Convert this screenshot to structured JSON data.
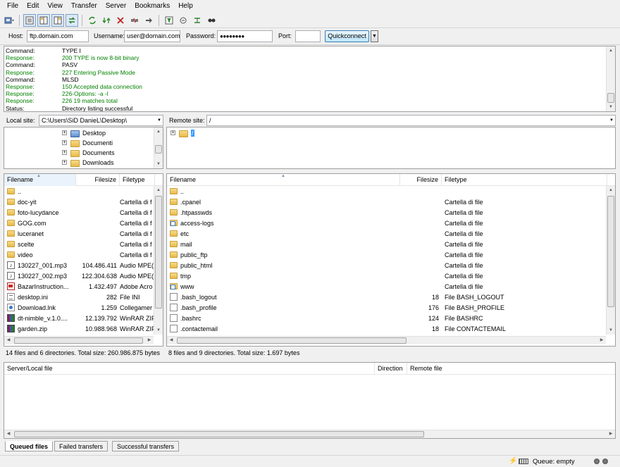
{
  "menu": [
    "File",
    "Edit",
    "View",
    "Transfer",
    "Server",
    "Bookmarks",
    "Help"
  ],
  "toolbar": {
    "icons": [
      "site-manager-icon",
      "toggle-message-log-icon",
      "toggle-local-tree-icon",
      "toggle-remote-tree-icon",
      "toggle-queue-icon",
      "refresh-icon",
      "process-queue-icon",
      "cancel-icon",
      "disconnect-icon",
      "reconnect-icon",
      "directory-filter-icon",
      "compare-icon",
      "sync-browse-icon",
      "search-icon"
    ]
  },
  "quickconnect": {
    "host_label": "Host:",
    "host_value": "ftp.domain.com",
    "username_label": "Username:",
    "username_value": "user@domain.com",
    "password_label": "Password:",
    "password_value": "●●●●●●●●",
    "port_label": "Port:",
    "port_value": "",
    "button_label": "Quickconnect"
  },
  "log": [
    {
      "type": "Command:",
      "msg": "TYPE I",
      "kind": "cmd"
    },
    {
      "type": "Response:",
      "msg": "200 TYPE is now 8-bit binary",
      "kind": "resp"
    },
    {
      "type": "Command:",
      "msg": "PASV",
      "kind": "cmd"
    },
    {
      "type": "Response:",
      "msg": "227 Entering Passive Mode",
      "kind": "resp"
    },
    {
      "type": "Command:",
      "msg": "MLSD",
      "kind": "cmd"
    },
    {
      "type": "Response:",
      "msg": "150 Accepted data connection",
      "kind": "resp"
    },
    {
      "type": "Response:",
      "msg": "226-Options: -a -l",
      "kind": "resp"
    },
    {
      "type": "Response:",
      "msg": "226 19 matches total",
      "kind": "resp"
    },
    {
      "type": "Status:",
      "msg": "Directory listing successful",
      "kind": "cmd"
    }
  ],
  "local": {
    "site_label": "Local site:",
    "path": "C:\\Users\\SiD DanieL\\Desktop\\",
    "tree": [
      "Desktop",
      "Documenti",
      "Documents",
      "Downloads"
    ],
    "columns": {
      "name": "Filename",
      "size": "Filesize",
      "type": "Filetype"
    },
    "files": [
      {
        "name": "..",
        "size": "",
        "type": "",
        "icon": "folder"
      },
      {
        "name": "doc-yit",
        "size": "",
        "type": "Cartella di f",
        "icon": "folder"
      },
      {
        "name": "foto-lucydance",
        "size": "",
        "type": "Cartella di f",
        "icon": "folder"
      },
      {
        "name": "GOG.com",
        "size": "",
        "type": "Cartella di f",
        "icon": "folder"
      },
      {
        "name": "luceranet",
        "size": "",
        "type": "Cartella di f",
        "icon": "folder"
      },
      {
        "name": "scelte",
        "size": "",
        "type": "Cartella di f",
        "icon": "folder"
      },
      {
        "name": "video",
        "size": "",
        "type": "Cartella di f",
        "icon": "folder"
      },
      {
        "name": "130227_001.mp3",
        "size": "104.486.411",
        "type": "Audio MPE(",
        "icon": "music"
      },
      {
        "name": "130227_002.mp3",
        "size": "122.304.638",
        "type": "Audio MPE(",
        "icon": "music"
      },
      {
        "name": "BazarInstruction...",
        "size": "1.432.497",
        "type": "Adobe Acro",
        "icon": "pdf"
      },
      {
        "name": "desktop.ini",
        "size": "282",
        "type": "File INI",
        "icon": "ini"
      },
      {
        "name": "Download.lnk",
        "size": "1.259",
        "type": "Collegamer",
        "icon": "link"
      },
      {
        "name": "dt-nimble_v.1.0....",
        "size": "12.139.792",
        "type": "WinRAR ZIF",
        "icon": "zip"
      },
      {
        "name": "garden.zip",
        "size": "10.988.968",
        "type": "WinRAR ZIF",
        "icon": "zip"
      }
    ],
    "status": "14 files and 6 directories. Total size: 260.986.875 bytes"
  },
  "remote": {
    "site_label": "Remote site:",
    "path": "/",
    "tree": [
      "/"
    ],
    "columns": {
      "name": "Filename",
      "size": "Filesize",
      "type": "Filetype"
    },
    "files": [
      {
        "name": "..",
        "size": "",
        "type": "",
        "icon": "folder"
      },
      {
        "name": ".cpanel",
        "size": "",
        "type": "Cartella di file",
        "icon": "folder"
      },
      {
        "name": ".htpasswds",
        "size": "",
        "type": "Cartella di file",
        "icon": "folder"
      },
      {
        "name": "access-logs",
        "size": "",
        "type": "Cartella di file",
        "icon": "dirlink"
      },
      {
        "name": "etc",
        "size": "",
        "type": "Cartella di file",
        "icon": "folder"
      },
      {
        "name": "mail",
        "size": "",
        "type": "Cartella di file",
        "icon": "folder"
      },
      {
        "name": "public_ftp",
        "size": "",
        "type": "Cartella di file",
        "icon": "folder"
      },
      {
        "name": "public_html",
        "size": "",
        "type": "Cartella di file",
        "icon": "folder"
      },
      {
        "name": "tmp",
        "size": "",
        "type": "Cartella di file",
        "icon": "folder"
      },
      {
        "name": "www",
        "size": "",
        "type": "Cartella di file",
        "icon": "dirlink"
      },
      {
        "name": ".bash_logout",
        "size": "18",
        "type": "File BASH_LOGOUT",
        "icon": "file"
      },
      {
        "name": ".bash_profile",
        "size": "176",
        "type": "File BASH_PROFILE",
        "icon": "file"
      },
      {
        "name": ".bashrc",
        "size": "124",
        "type": "File BASHRC",
        "icon": "file"
      },
      {
        "name": ".contactemail",
        "size": "18",
        "type": "File CONTACTEMAIL",
        "icon": "file"
      }
    ],
    "status": "8 files and 9 directories. Total size: 1.697 bytes"
  },
  "queue": {
    "columns": {
      "file": "Server/Local file",
      "direction": "Direction",
      "remote": "Remote file"
    },
    "tabs": [
      "Queued files",
      "Failed transfers",
      "Successful transfers"
    ],
    "active_tab": 0
  },
  "statusbar": {
    "queue": "Queue: empty"
  }
}
